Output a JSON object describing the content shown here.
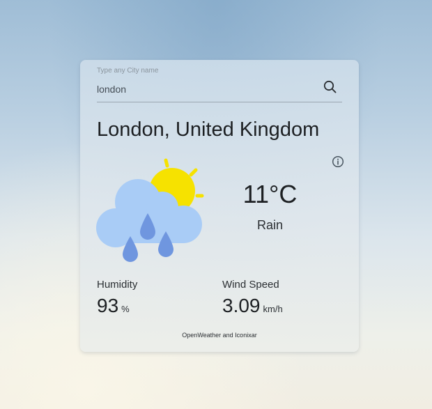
{
  "search": {
    "label": "Type any City name",
    "value": "london",
    "icon": "search-icon"
  },
  "location": {
    "title": "London, United Kingdom"
  },
  "info": {
    "icon": "info-icon"
  },
  "weather": {
    "icon": "cloud-rain-sun-icon",
    "temperature": "11°C",
    "condition": "Rain"
  },
  "humidity": {
    "label": "Humidity",
    "value": "93",
    "unit": "%"
  },
  "wind": {
    "label": "Wind Speed",
    "value": "3.09",
    "unit": "km/h"
  },
  "footer": {
    "credit": "OpenWeather and Iconixar"
  },
  "colors": {
    "sun": "#f6e200",
    "cloud": "#a9ccf6",
    "rain": "#6f96df"
  }
}
